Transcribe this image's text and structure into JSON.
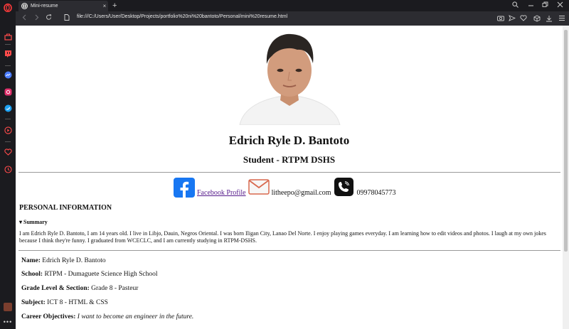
{
  "browser": {
    "tab_title": "Mini-resume",
    "tab_close": "×",
    "new_tab": "+",
    "url": "file:///C:/Users/User/Desktop/Projects/portfolio%20ni%20bantoto/Personal/mini%20resume.html"
  },
  "page": {
    "name": "Edrich Ryle D. Bantoto",
    "role": "Student - RTPM DSHS",
    "contacts": {
      "facebook_label": "Facebook Profile",
      "email": "litheepo@gmail.com",
      "phone": "09978045773"
    },
    "personal_heading": "PERSONAL INFORMATION",
    "summary_label": "▾ Summary",
    "summary_text": "I am Edrich Ryle D. Bantoto, I am 14 years old. I live in Libjo, Dauin, Negros Oriental. I was born Iligan City, Lanao Del Norte. I enjoy playing games everyday. I am learning how to edit videos and photos. I laugh at my own jokes because I think they're funny. I graduated from WCECLC, and I am currently studying in RTPM-DSHS.",
    "info": [
      {
        "label": "Name:",
        "value": "Edrich Ryle D. Bantoto"
      },
      {
        "label": "School:",
        "value": "RTPM - Dumaguete Science High School"
      },
      {
        "label": "Grade Level & Section:",
        "value": "Grade 8 - Pasteur"
      },
      {
        "label": "Subject:",
        "value": "ICT 8 - HTML & CSS"
      },
      {
        "label": "Career Objectives:",
        "value": "I want to become an engineer in the future."
      }
    ]
  }
}
